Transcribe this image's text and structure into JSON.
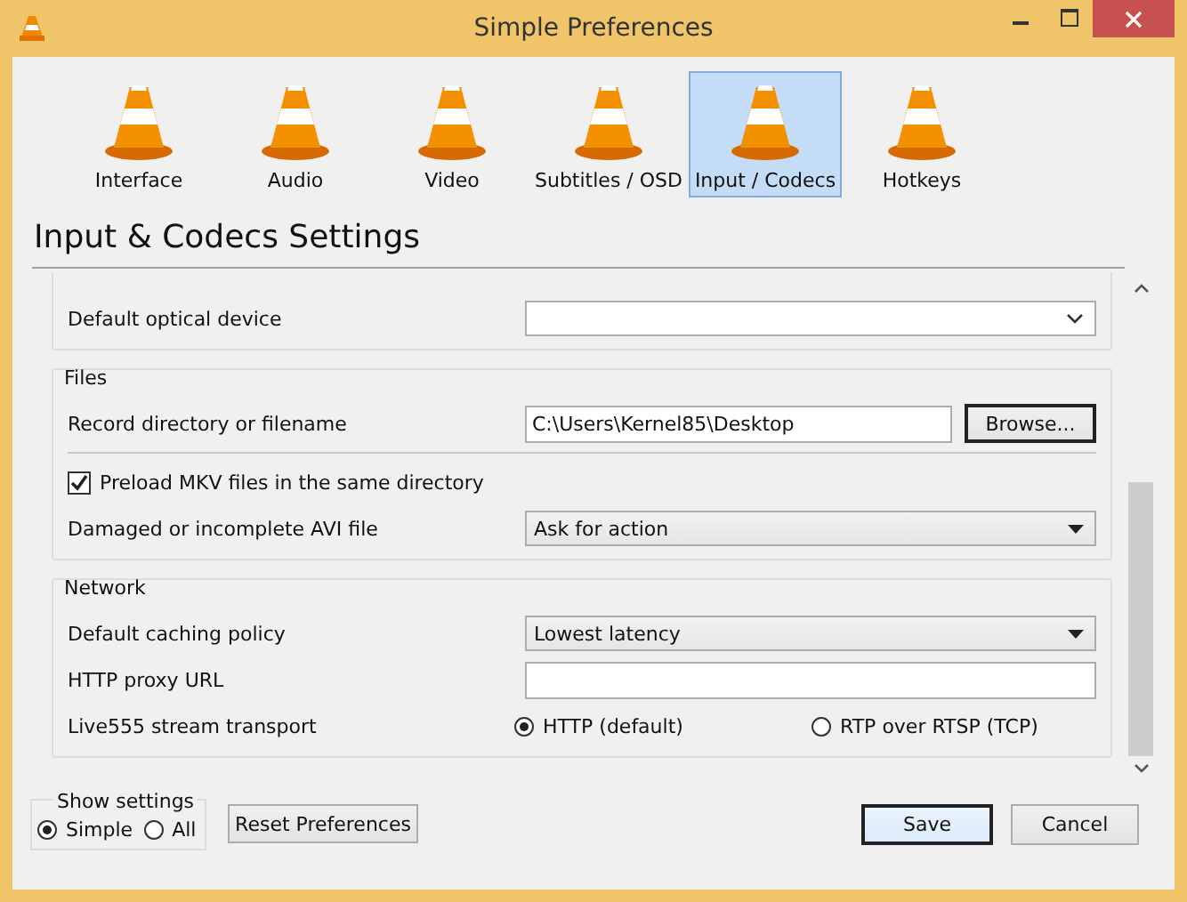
{
  "window": {
    "title": "Simple Preferences"
  },
  "tabs": [
    {
      "label": "Interface",
      "selected": false
    },
    {
      "label": "Audio",
      "selected": false
    },
    {
      "label": "Video",
      "selected": false
    },
    {
      "label": "Subtitles / OSD",
      "selected": false
    },
    {
      "label": "Input / Codecs",
      "selected": true
    },
    {
      "label": "Hotkeys",
      "selected": false
    }
  ],
  "heading": "Input & Codecs Settings",
  "groups": [
    {
      "rows": [
        {
          "kind": "combo",
          "label": "Default optical device",
          "value": ""
        }
      ]
    },
    {
      "title": "Files",
      "rows": [
        {
          "kind": "browse",
          "label": "Record directory or filename",
          "value": "C:\\Users\\Kernel85\\Desktop",
          "button": "Browse..."
        },
        {
          "kind": "rule"
        },
        {
          "kind": "checkbox",
          "label": "Preload MKV files in the same directory",
          "checked": true
        },
        {
          "kind": "select",
          "label": "Damaged or incomplete AVI file",
          "value": "Ask for action"
        }
      ]
    },
    {
      "title": "Network",
      "rows": [
        {
          "kind": "select",
          "label": "Default caching policy",
          "value": "Lowest latency"
        },
        {
          "kind": "text",
          "label": "HTTP proxy URL",
          "value": ""
        },
        {
          "kind": "radio",
          "label": "Live555 stream transport",
          "options": [
            {
              "label": "HTTP (default)",
              "selected": true
            },
            {
              "label": "RTP over RTSP (TCP)",
              "selected": false
            }
          ]
        }
      ]
    }
  ],
  "show_settings": {
    "title": "Show settings",
    "options": [
      {
        "label": "Simple",
        "selected": true
      },
      {
        "label": "All",
        "selected": false
      }
    ]
  },
  "buttons": {
    "reset": "Reset Preferences",
    "save": "Save",
    "cancel": "Cancel"
  }
}
